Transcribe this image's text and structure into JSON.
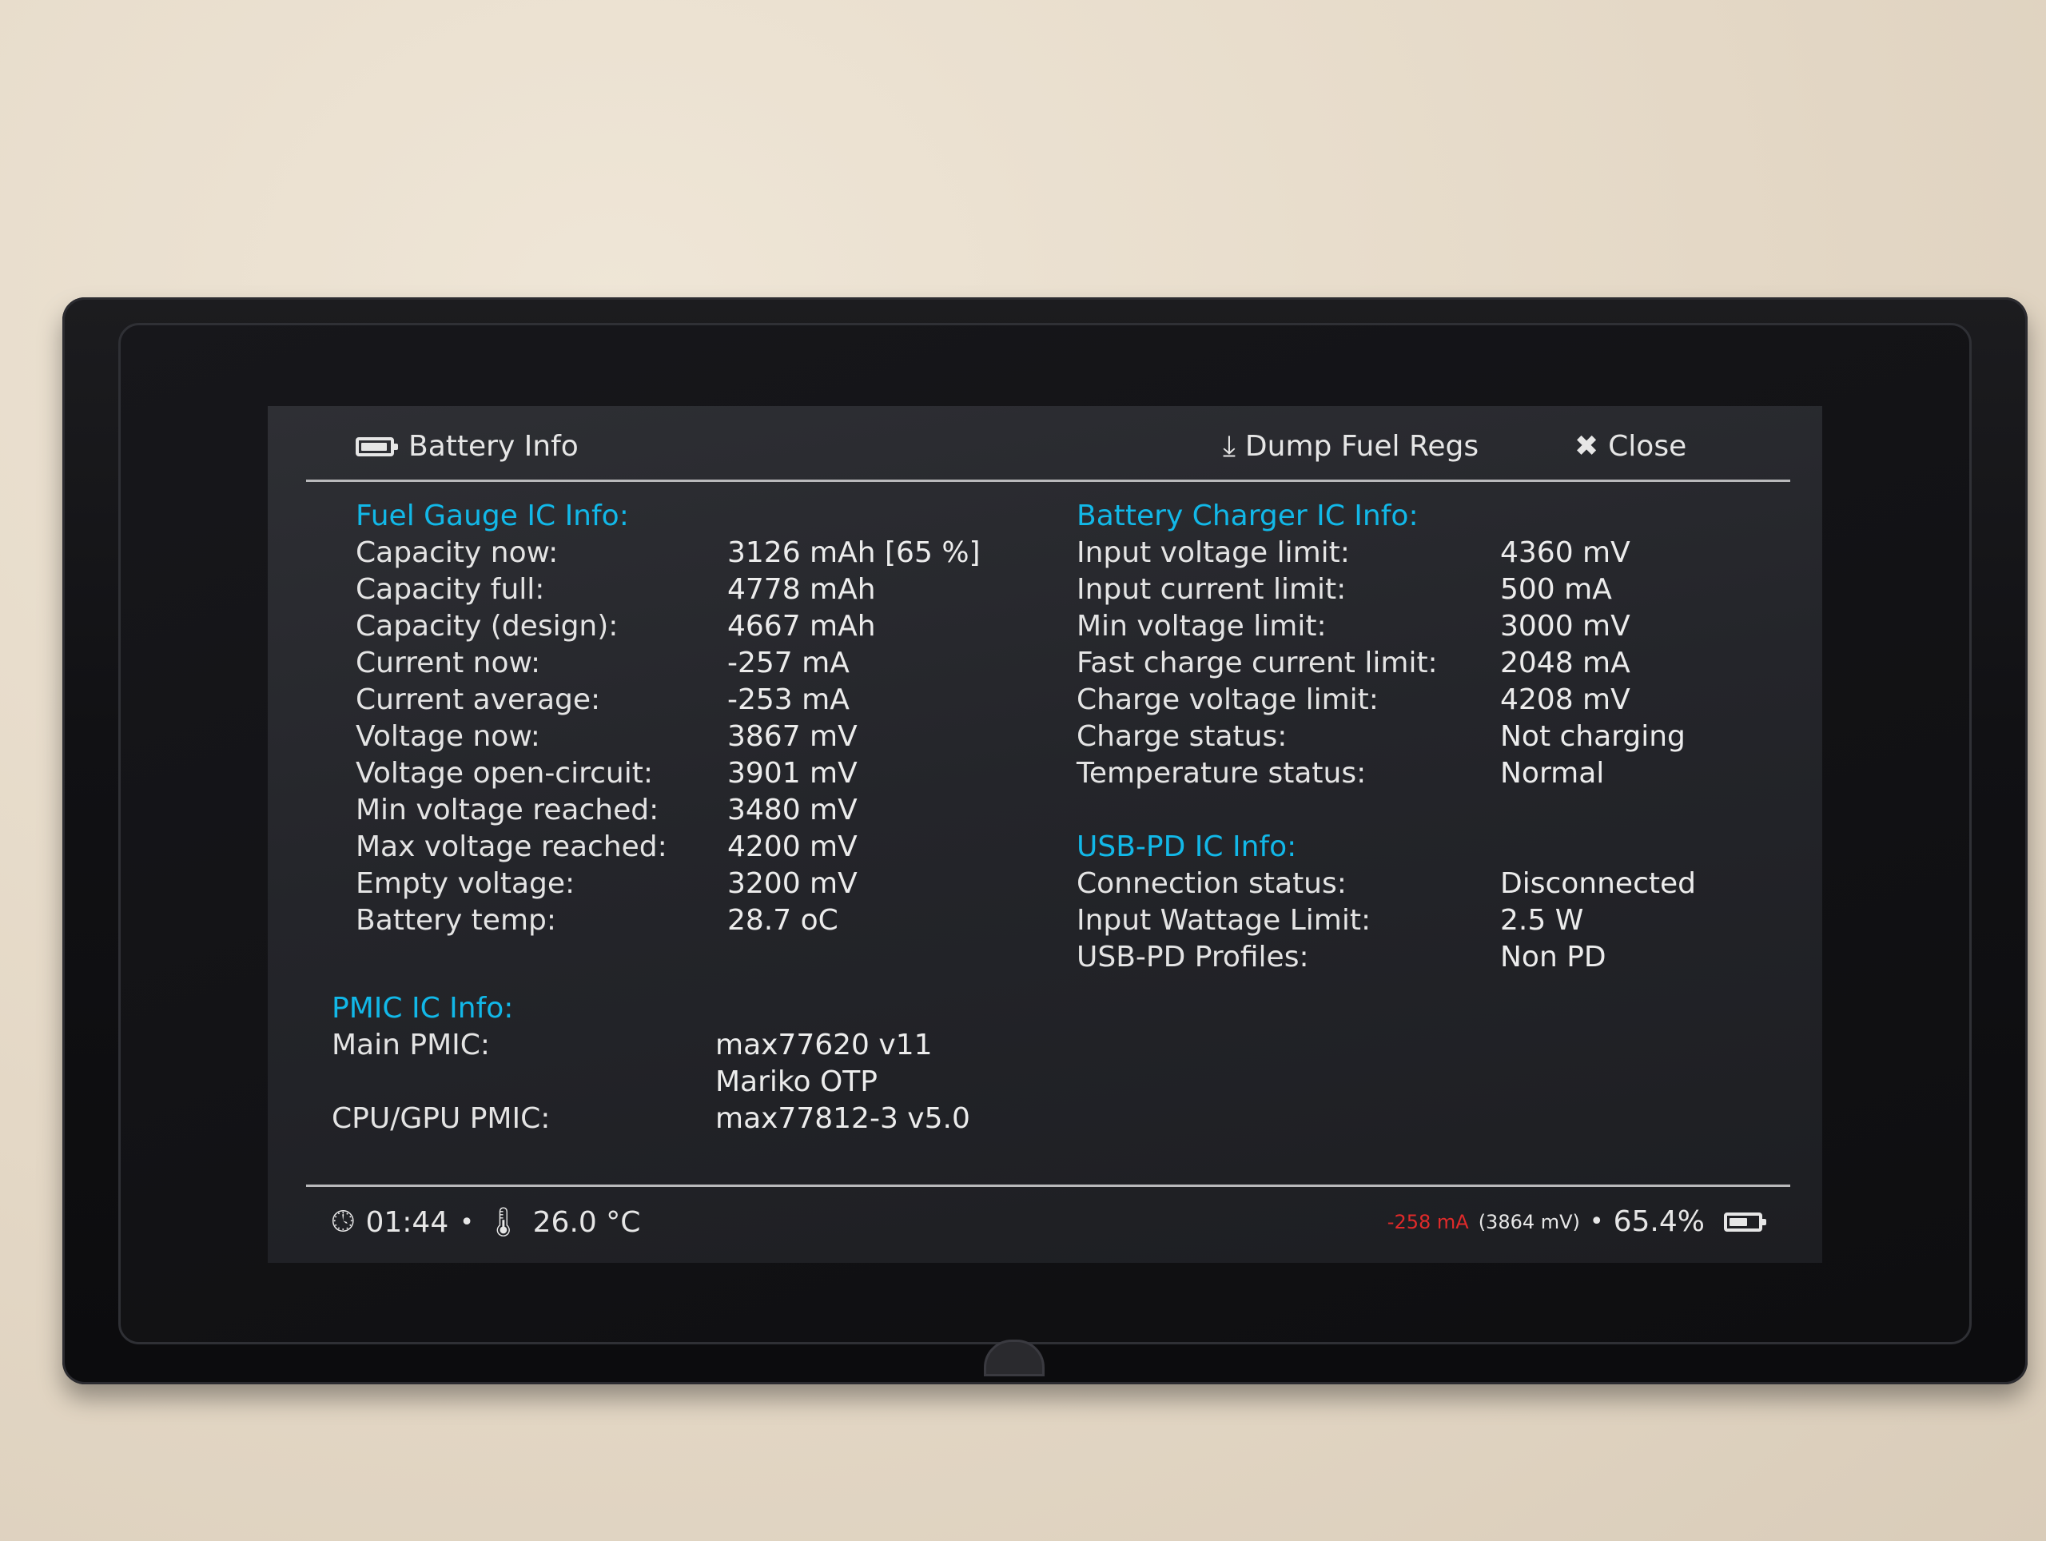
{
  "header": {
    "title": "Battery Info",
    "dump_label": "Dump Fuel Regs",
    "close_label": "Close"
  },
  "fuel_gauge": {
    "title": "Fuel Gauge IC Info:",
    "rows": [
      {
        "label": "Capacity now:",
        "value": "3126 mAh [65 %]"
      },
      {
        "label": "Capacity full:",
        "value": "4778 mAh"
      },
      {
        "label": "Capacity (design):",
        "value": "4667 mAh"
      },
      {
        "label": "Current now:",
        "value": "-257 mA"
      },
      {
        "label": "Current average:",
        "value": "-253 mA"
      },
      {
        "label": "Voltage now:",
        "value": "3867 mV"
      },
      {
        "label": "Voltage open-circuit:",
        "value": "3901 mV"
      },
      {
        "label": "Min voltage reached:",
        "value": "3480 mV"
      },
      {
        "label": "Max voltage reached:",
        "value": "4200 mV"
      },
      {
        "label": "Empty voltage:",
        "value": "3200 mV"
      },
      {
        "label": "Battery temp:",
        "value": "28.7 oC"
      }
    ]
  },
  "pmic": {
    "title": "PMIC IC Info:",
    "rows": [
      {
        "label": "Main PMIC:",
        "value": "max77620 v11"
      },
      {
        "label": "",
        "value": "Mariko OTP"
      },
      {
        "label": "CPU/GPU PMIC:",
        "value": "max77812-3 v5.0"
      }
    ]
  },
  "charger": {
    "title": "Battery Charger IC Info:",
    "rows": [
      {
        "label": "Input voltage limit:",
        "value": "4360 mV"
      },
      {
        "label": "Input current limit:",
        "value": "500 mA"
      },
      {
        "label": "Min voltage limit:",
        "value": "3000 mV"
      },
      {
        "label": "Fast charge current limit:",
        "value": "2048 mA"
      },
      {
        "label": "Charge voltage limit:",
        "value": "4208 mV"
      },
      {
        "label": "Charge status:",
        "value": "Not charging"
      },
      {
        "label": "Temperature status:",
        "value": "Normal"
      }
    ]
  },
  "usbpd": {
    "title": "USB-PD IC Info:",
    "rows": [
      {
        "label": "Connection status:",
        "value": "Disconnected"
      },
      {
        "label": "Input Wattage Limit:",
        "value": "2.5 W"
      },
      {
        "label": "USB-PD Profiles:",
        "value": "Non PD"
      }
    ]
  },
  "footer": {
    "time": "01:44",
    "temp": "26.0 °C",
    "current": "-258 mA",
    "voltage": "(3864 mV)",
    "percent": "65.4%",
    "battery_level": 0.654
  },
  "colors": {
    "accent": "#12b8e8",
    "warning_red": "#e02a2a",
    "screen_bg": "#2a2b30"
  }
}
